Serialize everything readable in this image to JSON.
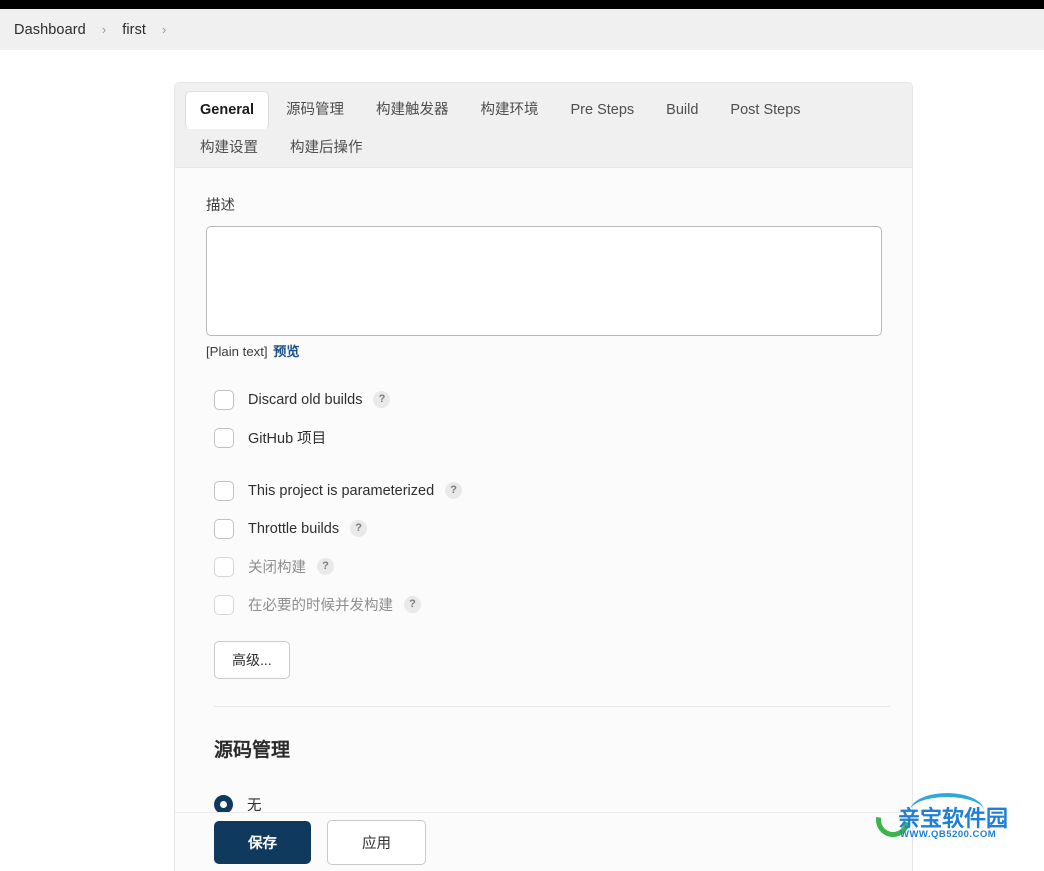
{
  "breadcrumb": {
    "items": [
      {
        "label": "Dashboard"
      },
      {
        "label": "first"
      }
    ],
    "separator": "›"
  },
  "tabs": [
    {
      "label": "General",
      "active": true
    },
    {
      "label": "源码管理",
      "active": false
    },
    {
      "label": "构建触发器",
      "active": false
    },
    {
      "label": "构建环境",
      "active": false
    },
    {
      "label": "Pre Steps",
      "active": false
    },
    {
      "label": "Build",
      "active": false
    },
    {
      "label": "Post Steps",
      "active": false
    },
    {
      "label": "构建设置",
      "active": false
    },
    {
      "label": "构建后操作",
      "active": false
    }
  ],
  "description": {
    "label": "描述",
    "value": "",
    "placeholder": "",
    "format_note": "[Plain text]",
    "preview_link": "预览"
  },
  "checkboxes": [
    {
      "label": "Discard old builds",
      "checked": false,
      "help": "?",
      "has_help": true,
      "muted": false
    },
    {
      "label": "GitHub 项目",
      "checked": false,
      "help": "?",
      "has_help": false,
      "muted": false
    },
    {
      "label": "This project is parameterized",
      "checked": false,
      "help": "?",
      "has_help": true,
      "muted": false
    },
    {
      "label": "Throttle builds",
      "checked": false,
      "help": "?",
      "has_help": true,
      "muted": false
    },
    {
      "label": "关闭构建",
      "checked": false,
      "help": "?",
      "has_help": true,
      "muted": true
    },
    {
      "label": "在必要的时候并发构建",
      "checked": false,
      "help": "?",
      "has_help": true,
      "muted": true
    }
  ],
  "advanced_button": {
    "label": "高级..."
  },
  "scm": {
    "heading": "源码管理",
    "selected_option": "无",
    "options": [
      "无"
    ]
  },
  "actions": {
    "save_label": "保存",
    "apply_label": "应用"
  },
  "watermark": {
    "title": "亲宝软件园",
    "url": "WWW.QB5200.COM"
  },
  "colors": {
    "accent_dark_blue": "#10395e",
    "link_blue": "#1b4f8a",
    "tab_bar_bg": "#f0f0f0",
    "panel_bg": "#fbfbfb",
    "breadcrumb_bg": "#f0f0f0",
    "watermark_blue": "#1f7fd6",
    "watermark_green": "#3bb44a"
  }
}
